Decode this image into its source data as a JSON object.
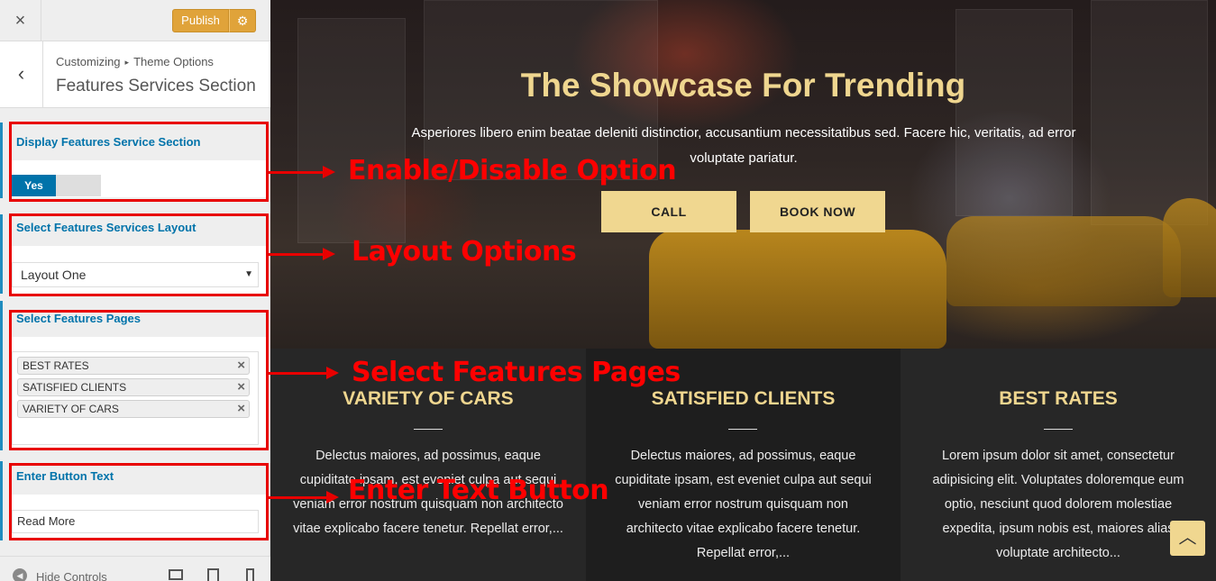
{
  "sidebar": {
    "close_icon": "×",
    "publish_label": "Publish",
    "settings_icon": "⚙",
    "back_icon": "‹",
    "breadcrumb_root": "Customizing",
    "breadcrumb_sep": "▸",
    "breadcrumb_parent": "Theme Options",
    "section_title": "Features Services Section",
    "display_label": "Display Features Service Section",
    "toggle_on_label": "Yes",
    "layout_label": "Select Features Services Layout",
    "layout_value": "Layout One",
    "select_caret": "▼",
    "pages_label": "Select Features Pages",
    "pages": [
      "BEST RATES",
      "SATISFIED CLIENTS",
      "VARIETY OF CARS"
    ],
    "remove_icon": "×",
    "button_text_label": "Enter Button Text",
    "button_text_value": "Read More",
    "hide_icon": "◀",
    "hide_label": "Hide Controls"
  },
  "hero": {
    "title": "The Showcase For Trending",
    "subtitle": "Asperiores libero enim beatae deleniti distinctior, accusantium necessitatibus sed. Facere hic, veritatis, ad error voluptate pariatur.",
    "call_label": "CALL",
    "book_label": "BOOK NOW"
  },
  "features": [
    {
      "title": "VARIETY OF CARS",
      "text": "Delectus maiores, ad possimus, eaque cupiditate ipsam, est eveniet culpa aut sequi veniam error nostrum quisquam non architecto vitae explicabo facere tenetur. Repellat error,..."
    },
    {
      "title": "SATISFIED CLIENTS",
      "text": "Delectus maiores, ad possimus, eaque cupiditate ipsam, est eveniet culpa aut sequi veniam error nostrum quisquam non architecto vitae explicabo facere tenetur. Repellat error,..."
    },
    {
      "title": "BEST RATES",
      "text": "Lorem ipsum dolor sit amet, consectetur adipisicing elit. Voluptates doloremque eum optio, nesciunt quod dolorem molestiae expedita, ipsum nobis est, maiores alias voluptate architecto..."
    }
  ],
  "scroll_top_icon": "︿",
  "annotations": {
    "enable": "Enable/Disable Option",
    "layout": "Layout Options",
    "pages": "Select Features Pages",
    "button": "Enter Text Button"
  },
  "colors": {
    "accent_blue": "#0073aa",
    "publish_orange": "#e0a33a",
    "gold": "#efd68f",
    "button_gold": "#f0d790",
    "annotation_red": "#e80000"
  }
}
